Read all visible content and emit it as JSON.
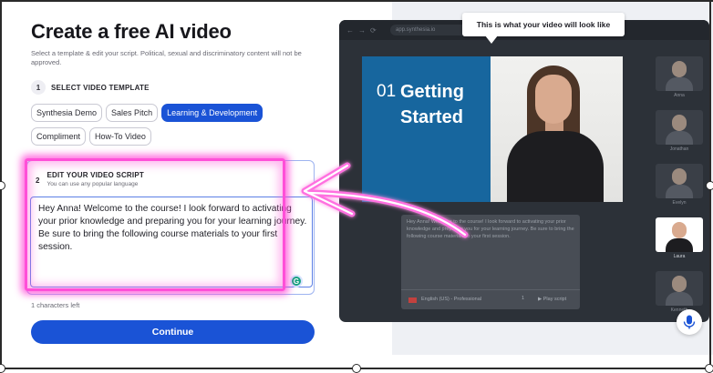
{
  "form": {
    "title": "Create a free AI video",
    "subtitle": "Select a template & edit your script. Political, sexual and discriminatory content will not be approved.",
    "step1": {
      "number": "1",
      "label": "SELECT VIDEO TEMPLATE"
    },
    "templates": [
      {
        "label": "Synthesia Demo",
        "active": false
      },
      {
        "label": "Sales Pitch",
        "active": false
      },
      {
        "label": "Learning & Development",
        "active": true
      },
      {
        "label": "Compliment",
        "active": false
      },
      {
        "label": "How-To Video",
        "active": false
      }
    ],
    "step2": {
      "number": "2",
      "label": "EDIT YOUR VIDEO SCRIPT",
      "hint": "You can use any popular language"
    },
    "script_text": "Hey Anna! Welcome to the course! I look forward to activating your prior knowledge and preparing you for your learning journey. Be sure to bring the following course materials to your first session.",
    "chars_left": "1 characters left",
    "continue_label": "Continue"
  },
  "preview": {
    "tooltip": "This is what your video will look like",
    "url": "app.synthesia.io",
    "slide_number": "01",
    "slide_title_line1": "Getting",
    "slide_title_line2": "Started",
    "script_preview": "Hey Anna! Welcome to the course! I look forward to activating your prior knowledge and preparing you for your learning journey. Be sure to bring the following course materials to your first session.",
    "language": "English (US) - Professional",
    "speed": "1",
    "play_label": "Play script",
    "avatars": [
      {
        "name": "Anna",
        "selected": false
      },
      {
        "name": "Jonathan",
        "selected": false
      },
      {
        "name": "Evelyn",
        "selected": false
      },
      {
        "name": "Laura",
        "selected": true
      },
      {
        "name": "Kenneth",
        "selected": false
      }
    ]
  },
  "colors": {
    "accent": "#1a53d6",
    "highlight": "#ff4fd8",
    "slide": "#17669e"
  }
}
